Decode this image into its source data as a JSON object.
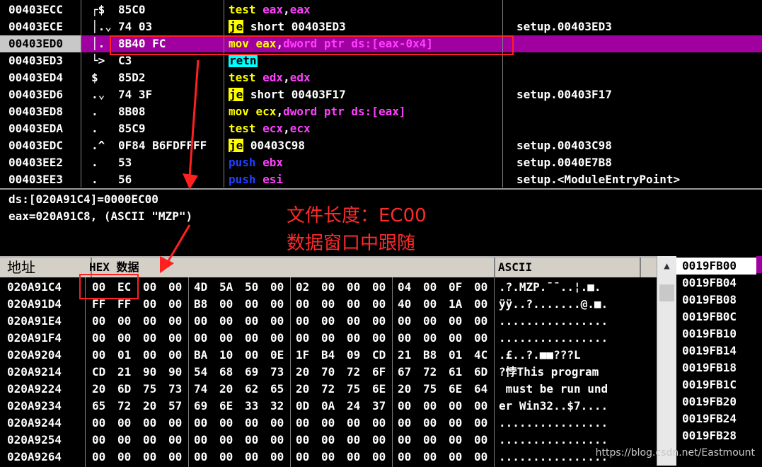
{
  "disasm": {
    "rows": [
      {
        "addr": "00403ECC",
        "mark": "┌$",
        "bytes": "85C0",
        "op": "test",
        "args": [
          {
            "t": "eax",
            "c": "reg"
          },
          {
            "t": ",",
            "c": "plain"
          },
          {
            "t": "eax",
            "c": "reg"
          }
        ],
        "opstyle": "op",
        "comment": ""
      },
      {
        "addr": "00403ECE",
        "mark": "│.⌄",
        "bytes": "74 03",
        "op": "je",
        "args": [
          {
            "t": " short 00403ED3",
            "c": "plain"
          }
        ],
        "opstyle": "jmp",
        "comment": "setup.00403ED3"
      },
      {
        "addr": "00403ED0",
        "mark": "│.",
        "bytes": "8B40 FC",
        "op": "mov",
        "args": [
          {
            "t": " eax",
            "c": "op"
          },
          {
            "t": ",",
            "c": "plain"
          },
          {
            "t": "dword ptr ds:[eax-0x4]",
            "c": "reg"
          }
        ],
        "opstyle": "op",
        "comment": ""
      },
      {
        "addr": "00403ED3",
        "mark": "└>",
        "bytes": "C3",
        "op": "retn",
        "args": [],
        "opstyle": "ret",
        "comment": ""
      },
      {
        "addr": "00403ED4",
        "mark": "$",
        "bytes": "85D2",
        "op": "test",
        "args": [
          {
            "t": " edx",
            "c": "reg"
          },
          {
            "t": ",",
            "c": "plain"
          },
          {
            "t": "edx",
            "c": "reg"
          }
        ],
        "opstyle": "op",
        "comment": ""
      },
      {
        "addr": "00403ED6",
        "mark": ".⌄",
        "bytes": "74 3F",
        "op": "je",
        "args": [
          {
            "t": " short 00403F17",
            "c": "plain"
          }
        ],
        "opstyle": "jmp",
        "comment": "setup.00403F17"
      },
      {
        "addr": "00403ED8",
        "mark": ".",
        "bytes": "8B08",
        "op": "mov",
        "args": [
          {
            "t": " ecx",
            "c": "op"
          },
          {
            "t": ",",
            "c": "plain"
          },
          {
            "t": "dword ptr ds:[eax]",
            "c": "reg"
          }
        ],
        "opstyle": "op",
        "comment": ""
      },
      {
        "addr": "00403EDA",
        "mark": ".",
        "bytes": "85C9",
        "op": "test",
        "args": [
          {
            "t": " ecx",
            "c": "reg"
          },
          {
            "t": ",",
            "c": "plain"
          },
          {
            "t": "ecx",
            "c": "reg"
          }
        ],
        "opstyle": "op",
        "comment": ""
      },
      {
        "addr": "00403EDC",
        "mark": ".^",
        "bytes": "0F84 B6FDFFFF",
        "op": "je",
        "args": [
          {
            "t": " 00403C98",
            "c": "plain"
          }
        ],
        "opstyle": "jmp",
        "comment": "setup.00403C98"
      },
      {
        "addr": "00403EE2",
        "mark": ".",
        "bytes": "53",
        "op": "push",
        "args": [
          {
            "t": " ebx",
            "c": "reg"
          }
        ],
        "opstyle": "push",
        "comment": "setup.0040E7B8"
      },
      {
        "addr": "00403EE3",
        "mark": ".",
        "bytes": "56",
        "op": "push",
        "args": [
          {
            "t": " esi",
            "c": "reg"
          }
        ],
        "opstyle": "push",
        "comment": "setup.<ModuleEntryPoint>"
      }
    ],
    "selected_index": 2
  },
  "info": {
    "line1": "ds:[020A91C4]=0000EC00",
    "line2": "eax=020A91C8, (ASCII \"MZP\")"
  },
  "annotations": {
    "file_length": "文件长度：EC00",
    "follow_dump": "数据窗口中跟随"
  },
  "dump": {
    "headers": {
      "address": "地址",
      "hex": "HEX 数据",
      "ascii": "ASCII"
    },
    "rows": [
      {
        "addr": "020A91C4",
        "bytes": [
          "00",
          "EC",
          "00",
          "00",
          "4D",
          "5A",
          "50",
          "00",
          "02",
          "00",
          "00",
          "00",
          "04",
          "00",
          "0F",
          "00"
        ],
        "ascii": ".?.MZP.¯¯..¦.■."
      },
      {
        "addr": "020A91D4",
        "bytes": [
          "FF",
          "FF",
          "00",
          "00",
          "B8",
          "00",
          "00",
          "00",
          "00",
          "00",
          "00",
          "00",
          "40",
          "00",
          "1A",
          "00"
        ],
        "ascii": "ÿÿ..?.......@.■."
      },
      {
        "addr": "020A91E4",
        "bytes": [
          "00",
          "00",
          "00",
          "00",
          "00",
          "00",
          "00",
          "00",
          "00",
          "00",
          "00",
          "00",
          "00",
          "00",
          "00",
          "00"
        ],
        "ascii": "................"
      },
      {
        "addr": "020A91F4",
        "bytes": [
          "00",
          "00",
          "00",
          "00",
          "00",
          "00",
          "00",
          "00",
          "00",
          "00",
          "00",
          "00",
          "00",
          "00",
          "00",
          "00"
        ],
        "ascii": "................"
      },
      {
        "addr": "020A9204",
        "bytes": [
          "00",
          "01",
          "00",
          "00",
          "BA",
          "10",
          "00",
          "0E",
          "1F",
          "B4",
          "09",
          "CD",
          "21",
          "B8",
          "01",
          "4C"
        ],
        "ascii": ".£..?.■■???L"
      },
      {
        "addr": "020A9214",
        "bytes": [
          "CD",
          "21",
          "90",
          "90",
          "54",
          "68",
          "69",
          "73",
          "20",
          "70",
          "72",
          "6F",
          "67",
          "72",
          "61",
          "6D"
        ],
        "ascii": "?悖This program"
      },
      {
        "addr": "020A9224",
        "bytes": [
          "20",
          "6D",
          "75",
          "73",
          "74",
          "20",
          "62",
          "65",
          "20",
          "72",
          "75",
          "6E",
          "20",
          "75",
          "6E",
          "64"
        ],
        "ascii": " must be run und"
      },
      {
        "addr": "020A9234",
        "bytes": [
          "65",
          "72",
          "20",
          "57",
          "69",
          "6E",
          "33",
          "32",
          "0D",
          "0A",
          "24",
          "37",
          "00",
          "00",
          "00",
          "00"
        ],
        "ascii": "er Win32..$7...."
      },
      {
        "addr": "020A9244",
        "bytes": [
          "00",
          "00",
          "00",
          "00",
          "00",
          "00",
          "00",
          "00",
          "00",
          "00",
          "00",
          "00",
          "00",
          "00",
          "00",
          "00"
        ],
        "ascii": "................"
      },
      {
        "addr": "020A9254",
        "bytes": [
          "00",
          "00",
          "00",
          "00",
          "00",
          "00",
          "00",
          "00",
          "00",
          "00",
          "00",
          "00",
          "00",
          "00",
          "00",
          "00"
        ],
        "ascii": "................"
      },
      {
        "addr": "020A9264",
        "bytes": [
          "00",
          "00",
          "00",
          "00",
          "00",
          "00",
          "00",
          "00",
          "00",
          "00",
          "00",
          "00",
          "00",
          "00",
          "00",
          "00"
        ],
        "ascii": "................"
      }
    ]
  },
  "stack": {
    "rows": [
      "0019FB00",
      "0019FB04",
      "0019FB08",
      "0019FB0C",
      "0019FB10",
      "0019FB14",
      "0019FB18",
      "0019FB1C",
      "0019FB20",
      "0019FB24",
      "0019FB28"
    ]
  },
  "watermark": "https://blog.csdn.net/Eastmount",
  "colors": {
    "highlight_box": "#ff2020",
    "selected_row": "#a000a0",
    "mnemonic": "#ffff00",
    "register": "#ff40ff"
  }
}
